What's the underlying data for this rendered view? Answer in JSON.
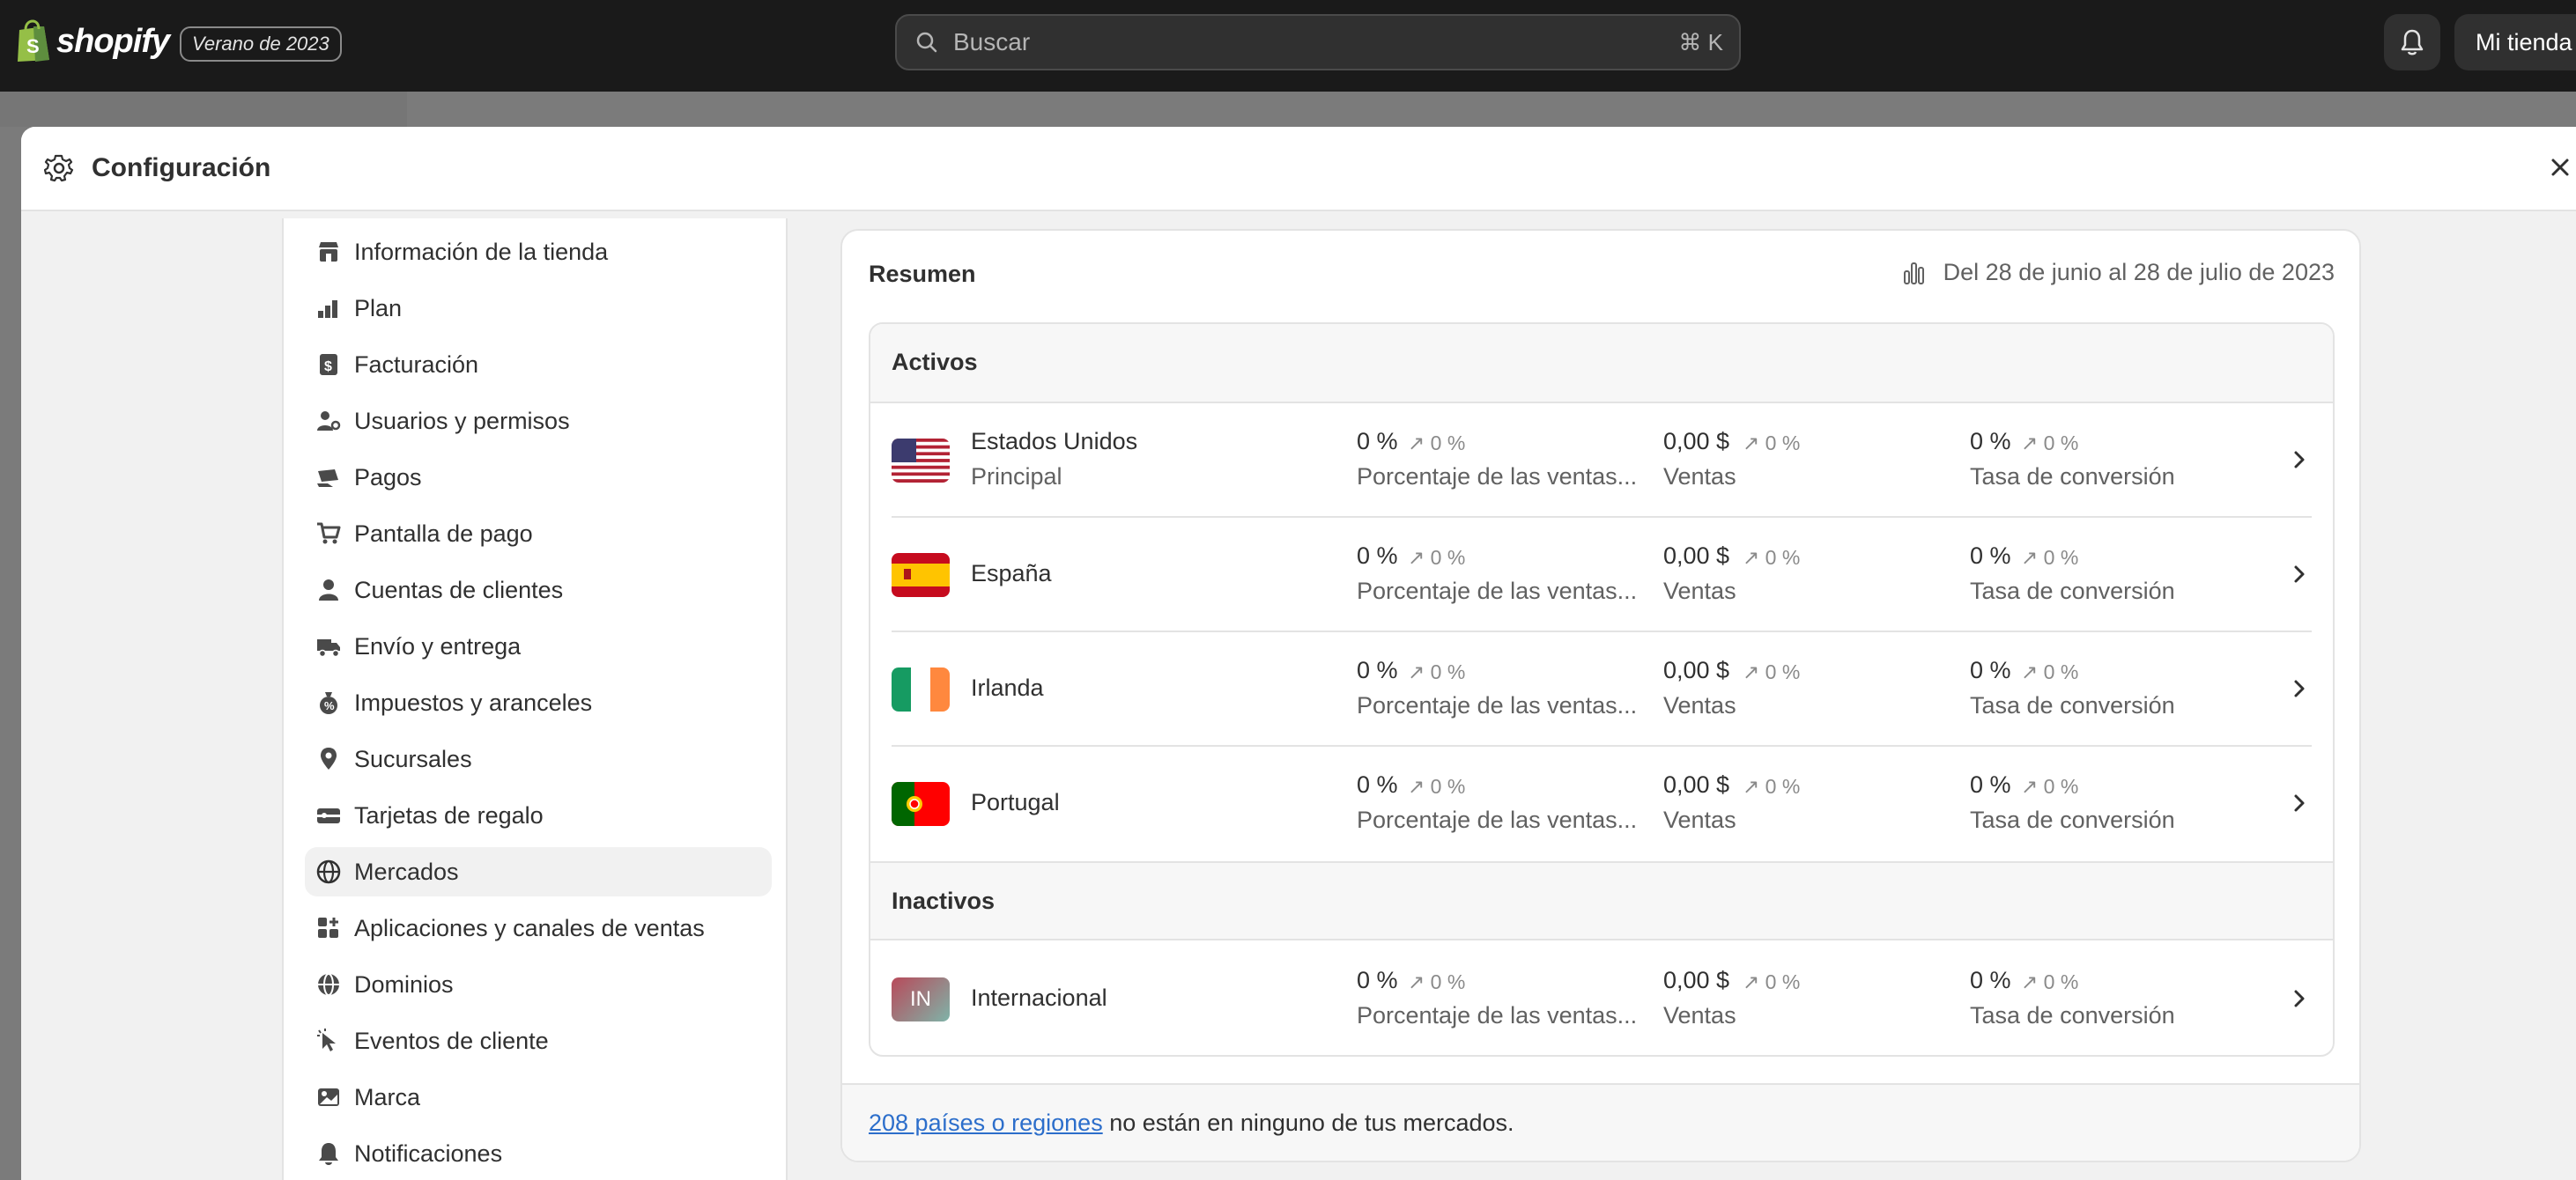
{
  "topbar": {
    "brand": "shopify",
    "edition": "Verano de 2023",
    "search_placeholder": "Buscar",
    "search_shortcut": "⌘ K",
    "store_name": "Mi tienda"
  },
  "modal": {
    "title": "Configuración"
  },
  "sidebar": {
    "items": [
      {
        "label": "Información de la tienda",
        "icon": "store-icon"
      },
      {
        "label": "Plan",
        "icon": "plan-icon"
      },
      {
        "label": "Facturación",
        "icon": "billing-icon"
      },
      {
        "label": "Usuarios y permisos",
        "icon": "users-icon"
      },
      {
        "label": "Pagos",
        "icon": "payments-icon"
      },
      {
        "label": "Pantalla de pago",
        "icon": "cart-icon"
      },
      {
        "label": "Cuentas de clientes",
        "icon": "person-icon"
      },
      {
        "label": "Envío y entrega",
        "icon": "truck-icon"
      },
      {
        "label": "Impuestos y aranceles",
        "icon": "tax-icon"
      },
      {
        "label": "Sucursales",
        "icon": "location-icon"
      },
      {
        "label": "Tarjetas de regalo",
        "icon": "gift-card-icon"
      },
      {
        "label": "Mercados",
        "icon": "globe-icon",
        "active": true
      },
      {
        "label": "Aplicaciones y canales de ventas",
        "icon": "apps-icon"
      },
      {
        "label": "Dominios",
        "icon": "domains-icon"
      },
      {
        "label": "Eventos de cliente",
        "icon": "cursor-icon"
      },
      {
        "label": "Marca",
        "icon": "brand-icon"
      },
      {
        "label": "Notificaciones",
        "icon": "bell-icon"
      }
    ]
  },
  "summary": {
    "title": "Resumen",
    "date_range": "Del 28 de junio al 28 de julio de 2023",
    "active_heading": "Activos",
    "inactive_heading": "Inactivos",
    "metric_labels": {
      "share": "Porcentaje de las ventas...",
      "sales": "Ventas",
      "conversion": "Tasa de conversión"
    },
    "active_markets": [
      {
        "name": "Estados Unidos",
        "subtitle": "Principal",
        "flag": "us",
        "share": "0 %",
        "share_trend": "↗ 0 %",
        "sales": "0,00 $",
        "sales_trend": "↗ 0 %",
        "conversion": "0 %",
        "conversion_trend": "↗ 0 %"
      },
      {
        "name": "España",
        "subtitle": "",
        "flag": "es",
        "share": "0 %",
        "share_trend": "↗ 0 %",
        "sales": "0,00 $",
        "sales_trend": "↗ 0 %",
        "conversion": "0 %",
        "conversion_trend": "↗ 0 %"
      },
      {
        "name": "Irlanda",
        "subtitle": "",
        "flag": "ie",
        "share": "0 %",
        "share_trend": "↗ 0 %",
        "sales": "0,00 $",
        "sales_trend": "↗ 0 %",
        "conversion": "0 %",
        "conversion_trend": "↗ 0 %"
      },
      {
        "name": "Portugal",
        "subtitle": "",
        "flag": "pt",
        "share": "0 %",
        "share_trend": "↗ 0 %",
        "sales": "0,00 $",
        "sales_trend": "↗ 0 %",
        "conversion": "0 %",
        "conversion_trend": "↗ 0 %"
      }
    ],
    "inactive_markets": [
      {
        "name": "Internacional",
        "flag_text": "IN",
        "share": "0 %",
        "share_trend": "↗ 0 %",
        "sales": "0,00 $",
        "sales_trend": "↗ 0 %",
        "conversion": "0 %",
        "conversion_trend": "↗ 0 %"
      }
    ],
    "footer_link": "208 países o regiones",
    "footer_text": " no están en ninguno de tus mercados."
  },
  "colors": {
    "topbar": "#1a1a1a",
    "link": "#2c6ecb",
    "active_nav": "#f1f1f1"
  }
}
